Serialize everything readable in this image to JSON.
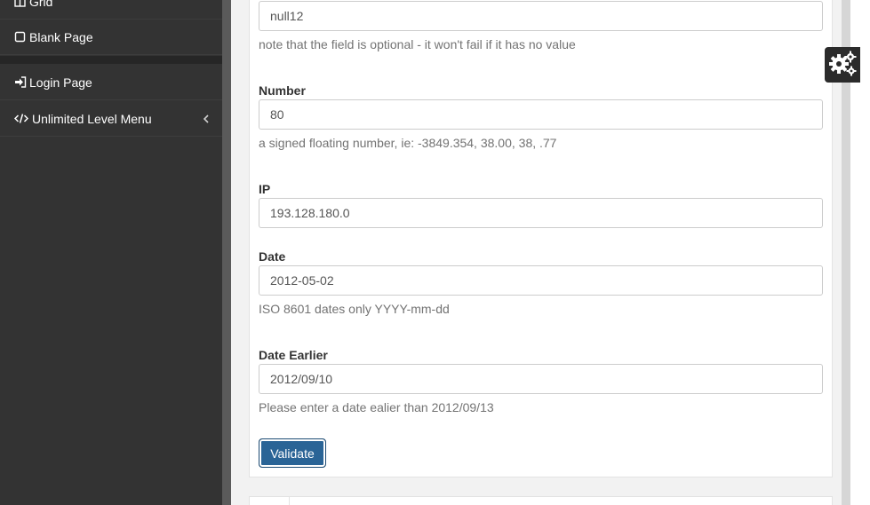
{
  "sidebar": {
    "items": [
      {
        "label": "Grid",
        "icon": "grid-icon"
      },
      {
        "label": "Blank Page",
        "icon": "square-icon"
      },
      {
        "label": "Login Page",
        "icon": "sign-in-icon"
      },
      {
        "label": "Unlimited Level Menu",
        "icon": "code-icon"
      }
    ]
  },
  "form": {
    "field_top": {
      "value": "null12",
      "help": "note that the field is optional - it won't fail if it has no value"
    },
    "number": {
      "label": "Number",
      "value": "80",
      "help": "a signed floating number, ie: -3849.354, 38.00, 38, .77"
    },
    "ip": {
      "label": "IP",
      "value": "193.128.180.0"
    },
    "date": {
      "label": "Date",
      "value": "2012-05-02",
      "help": "ISO 8601 dates only YYYY-mm-dd"
    },
    "date_earlier": {
      "label": "Date Earlier",
      "value": "2012/09/10",
      "help": "Please enter a date ealier than 2012/09/13"
    },
    "validate_label": "Validate"
  },
  "colors": {
    "sidebar_bg": "#333333",
    "button_bg": "#2a6496"
  }
}
